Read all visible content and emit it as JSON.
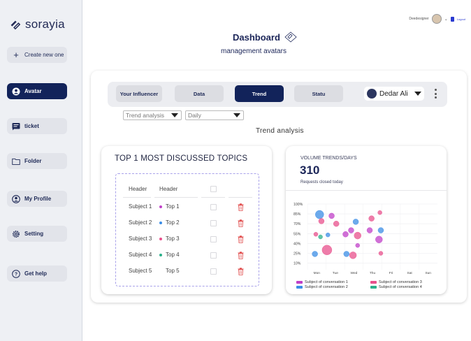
{
  "brand": {
    "name": "sorayia"
  },
  "sidebar": {
    "create_label": "Create new one",
    "items": [
      {
        "label": "Avatar"
      },
      {
        "label": "ticket"
      },
      {
        "label": "Folder"
      },
      {
        "label": "My Profile"
      },
      {
        "label": "Setting"
      },
      {
        "label": "Get help"
      }
    ]
  },
  "header": {
    "title": "Dashboard",
    "subtitle": "management avatars",
    "user_name": "Deedesigner",
    "logout_label": "Logout"
  },
  "tabs": [
    {
      "label": "Your Influencer"
    },
    {
      "label": "Data"
    },
    {
      "label": "Trend"
    },
    {
      "label": "Statu"
    }
  ],
  "user_select": {
    "value": "Dedar Ali"
  },
  "filters": {
    "analysis": "Trend analysis",
    "period": "Daily"
  },
  "section_title": "Trend analysis",
  "topics": {
    "title": "TOP 1 MOST DISCUSSED TOPICS",
    "headers": [
      "Header",
      "Header"
    ],
    "rows": [
      {
        "subject": "Subject 1",
        "topic": "Top 1",
        "color": "#c040c8"
      },
      {
        "subject": "Subject 2",
        "topic": "Top 2",
        "color": "#3b8de6"
      },
      {
        "subject": "Subject 3",
        "topic": "Top 3",
        "color": "#e8508c"
      },
      {
        "subject": "Subject 4",
        "topic": "Top 4",
        "color": "#2bb08a"
      },
      {
        "subject": "Subject 5",
        "topic": "Top 5",
        "color": "#ffffff"
      }
    ]
  },
  "volume": {
    "title": "VOLUME TRENDS/DAYS",
    "value": "310",
    "subtitle": "Requests closed today"
  },
  "chart_data": {
    "type": "scatter",
    "categories": [
      "Mon",
      "Tue",
      "Wed",
      "Thu",
      "Fri",
      "Sat",
      "Sun"
    ],
    "y_ticks": [
      "100%",
      "85%",
      "70%",
      "55%",
      "40%",
      "25%",
      "10%"
    ],
    "ylim": [
      0,
      100
    ],
    "grid": true,
    "legend_position": "bottom",
    "series": [
      {
        "name": "Subject of conversation 1",
        "color": "#c040c8",
        "points": [
          {
            "x": 1.15,
            "y": 82,
            "r": 4
          },
          {
            "x": 1.9,
            "y": 54,
            "r": 4
          },
          {
            "x": 2.2,
            "y": 60,
            "r": 4
          },
          {
            "x": 2.55,
            "y": 37,
            "r": 3
          },
          {
            "x": 3.2,
            "y": 60,
            "r": 4
          },
          {
            "x": 3.7,
            "y": 46,
            "r": 5
          }
        ]
      },
      {
        "name": "Subject of conversation 2",
        "color": "#3b8de6",
        "points": [
          {
            "x": 0.25,
            "y": 24,
            "r": 4
          },
          {
            "x": 0.5,
            "y": 84,
            "r": 6
          },
          {
            "x": 0.95,
            "y": 53,
            "r": 3
          },
          {
            "x": 1.95,
            "y": 24,
            "r": 4
          },
          {
            "x": 2.45,
            "y": 73,
            "r": 4
          },
          {
            "x": 3.8,
            "y": 60,
            "r": 4
          }
        ]
      },
      {
        "name": "Subject of conversation 3",
        "color": "#e8508c",
        "points": [
          {
            "x": 0.3,
            "y": 54,
            "r": 3
          },
          {
            "x": 0.6,
            "y": 74,
            "r": 4
          },
          {
            "x": 0.9,
            "y": 30,
            "r": 7
          },
          {
            "x": 1.4,
            "y": 70,
            "r": 4
          },
          {
            "x": 2.3,
            "y": 22,
            "r": 5
          },
          {
            "x": 2.55,
            "y": 52,
            "r": 5
          },
          {
            "x": 3.3,
            "y": 78,
            "r": 4
          },
          {
            "x": 3.75,
            "y": 87,
            "r": 3
          },
          {
            "x": 3.8,
            "y": 25,
            "r": 3
          }
        ]
      },
      {
        "name": "Subject of conversation 4",
        "color": "#2bb08a",
        "points": [
          {
            "x": 0.55,
            "y": 50,
            "r": 3
          }
        ]
      }
    ]
  }
}
